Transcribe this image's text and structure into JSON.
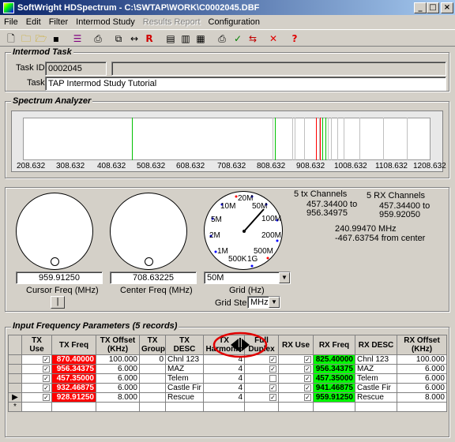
{
  "window": {
    "title": "SoftWright HDSpectrum - C:\\SWTAP\\WORK\\C0002045.DBF"
  },
  "menu": [
    "File",
    "Edit",
    "Filter",
    "Intermod Study",
    "Results Report",
    "Configuration"
  ],
  "toolbar_icons": [
    "new-icon",
    "open-icon",
    "open-db-icon",
    "save-icon",
    "list-icon",
    "print-preview-icon",
    "copy-icon",
    "arrows-icon",
    "r-icon",
    "chart-icon",
    "table-icon",
    "grid-icon",
    "print-icon",
    "check-icon",
    "compare-icon",
    "close-icon",
    "help-icon"
  ],
  "intermod": {
    "group_title": "Intermod Task",
    "task_id_label": "Task ID:",
    "task_id": "0002045",
    "task_label": "Task",
    "task": "TAP Intermod Study Tutorial"
  },
  "spectrum": {
    "group_title": "Spectrum Analyzer",
    "ticks": [
      "208.632",
      "308.632",
      "408.632",
      "508.632",
      "608.632",
      "708.632",
      "808.632",
      "908.632",
      "1008.632",
      "1108.632",
      "1208.632"
    ]
  },
  "controls": {
    "cursor_freq": "959.91250",
    "cursor_label": "Cursor Freq (MHz)",
    "center_freq": "708.63225",
    "center_label": "Center Freq (MHz)",
    "small_button": "|",
    "grid_value": "50M",
    "grid_label": "Grid (Hz)",
    "grid_step_label": "Grid Step",
    "grid_step_value": "MHz",
    "dial_labels": [
      "1M",
      "2M",
      "5M",
      "10M",
      "20M",
      "50M",
      "100M",
      "200M",
      "500M",
      "1G",
      "500K"
    ]
  },
  "info": {
    "tx_channels": "5 tx Channels",
    "tx_range_1": "457.34400 to",
    "tx_range_2": "956.34975",
    "rx_channels": "5 RX Channels",
    "rx_range_1": "457.34400 to",
    "rx_range_2": "959.92050",
    "freq": "240.99470 MHz",
    "from_center": "-467.63754 from center"
  },
  "grid": {
    "group_title": "Input Frequency Parameters (5 records)",
    "headers": [
      "TX Use",
      "TX Freq",
      "TX Offset (KHz)",
      "TX Group",
      "TX DESC",
      "TX Harmonic",
      "Full Duplex",
      "RX Use",
      "RX Freq",
      "RX DESC",
      "RX Offset (KHz)"
    ],
    "rows": [
      {
        "tx_freq": "870.40000",
        "tx_offset": "100.000",
        "tx_group": "0",
        "tx_desc": "Chnl 123",
        "harm": "4",
        "duplex": true,
        "rx_freq": "825.40000",
        "rx_desc": "Chnl 123",
        "rx_offset": "100.000",
        "marker": ""
      },
      {
        "tx_freq": "956.34375",
        "tx_offset": "6.000",
        "tx_group": "",
        "tx_desc": "MAZ",
        "harm": "4",
        "duplex": true,
        "rx_freq": "956.34375",
        "rx_desc": "MAZ",
        "rx_offset": "6.000",
        "marker": ""
      },
      {
        "tx_freq": "457.35000",
        "tx_offset": "6.000",
        "tx_group": "",
        "tx_desc": "Telem",
        "harm": "4",
        "duplex": false,
        "rx_freq": "457.35000",
        "rx_desc": "Telem",
        "rx_offset": "6.000",
        "marker": ""
      },
      {
        "tx_freq": "932.46875",
        "tx_offset": "6.000",
        "tx_group": "",
        "tx_desc": "Castle Fir",
        "harm": "4",
        "duplex": true,
        "rx_freq": "941.46875",
        "rx_desc": "Castle Fir",
        "rx_offset": "6.000",
        "marker": ""
      },
      {
        "tx_freq": "928.91250",
        "tx_offset": "8.000",
        "tx_group": "",
        "tx_desc": "Rescue",
        "harm": "4",
        "duplex": true,
        "rx_freq": "959.91250",
        "rx_desc": "Rescue",
        "rx_offset": "8.000",
        "marker": "▶"
      }
    ],
    "new_row_marker": "*"
  }
}
